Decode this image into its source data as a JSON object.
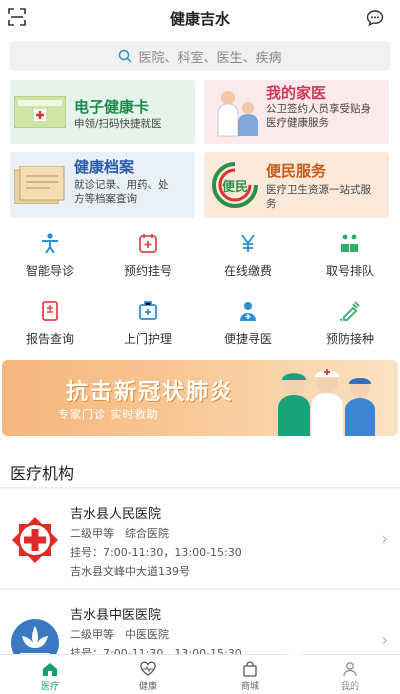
{
  "header": {
    "title": "健康吉水"
  },
  "search": {
    "placeholder": "医院、科室、医生、疾病"
  },
  "cards": [
    {
      "title": "电子健康卡",
      "desc": "申领/扫码快捷就医",
      "thumb_text": "电子健康卡",
      "title_color": "#1f8a4c"
    },
    {
      "title": "我的家医",
      "desc": "公卫签约人员享受贴身医疗健康服务",
      "title_color": "#d23b57"
    },
    {
      "title": "健康档案",
      "desc": "就诊记录、用药、处方等档案查询",
      "thumb_text": "健康档案",
      "title_color": "#2b5aa6"
    },
    {
      "title": "便民服务",
      "desc": "医疗卫生资源一站式服务",
      "thumb_text": "便民",
      "title_color": "#c95a14"
    }
  ],
  "grid": [
    {
      "label": "智能导诊",
      "icon": "guide-icon"
    },
    {
      "label": "预约挂号",
      "icon": "register-icon"
    },
    {
      "label": "在线缴费",
      "icon": "yuan-icon"
    },
    {
      "label": "取号排队",
      "icon": "queue-icon"
    },
    {
      "label": "报告查询",
      "icon": "report-icon"
    },
    {
      "label": "上门护理",
      "icon": "nurse-icon"
    },
    {
      "label": "便捷寻医",
      "icon": "doctor-icon"
    },
    {
      "label": "预防接种",
      "icon": "vaccine-icon"
    }
  ],
  "banner": {
    "title": "抗击新冠状肺炎",
    "subtitle": "专家门诊 实时救助"
  },
  "section": {
    "title": "医疗机构"
  },
  "institutions": [
    {
      "name": "吉水县人民医院",
      "level": "二级甲等　综合医院",
      "hours": "挂号：7:00-11:30，13:00-15:30",
      "address": "吉水县文峰中大道139号"
    },
    {
      "name": "吉水县中医医院",
      "level": "二级甲等　中医医院",
      "hours": "挂号：7:00-11:30，13:00-15:30"
    }
  ],
  "tabs": [
    {
      "label": "医疗",
      "active": true
    },
    {
      "label": "健康"
    },
    {
      "label": "商城"
    },
    {
      "label": "我的"
    }
  ],
  "colors": {
    "accent": "#14a06e",
    "icon": "#2a8fd6"
  }
}
